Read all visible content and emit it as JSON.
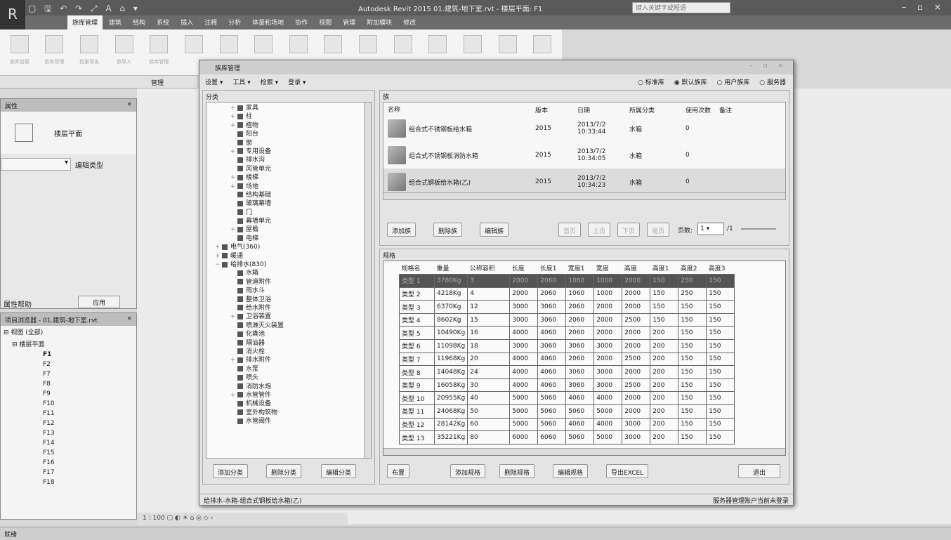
{
  "app": {
    "title": "Autodesk Revit 2015    01.建筑-地下室.rvt - 楼层平面: F1",
    "search_placeholder": "键入关键字或短语",
    "quick_access": "▢ 🖫 ↶ ↷ ⤢ A ⌂ ▾",
    "window_controls": "– ▫ ×",
    "app_button": "R"
  },
  "ribbon": {
    "tabs": [
      "族库管理",
      "建筑",
      "结构",
      "系统",
      "插入",
      "注释",
      "分析",
      "体量和场地",
      "协作",
      "视图",
      "管理",
      "附加模块",
      "修改"
    ],
    "buttons": [
      "族库加载",
      "族库管理",
      "批量导出",
      "族导入",
      "族库管理"
    ],
    "panel_label": "管理"
  },
  "properties": {
    "title": "属性",
    "close": "×",
    "type_name": "楼层平面",
    "edit_type": "编辑类型",
    "help": "属性帮助",
    "apply": "应用"
  },
  "browser": {
    "title": "项目浏览器 - 01.建筑-地下室.rvt",
    "close": "×",
    "root": "视图 (全部)",
    "group": "楼层平面",
    "levels": [
      "F1",
      "F2",
      "F7",
      "F8",
      "F9",
      "F10",
      "F11",
      "F12",
      "F13",
      "F14",
      "F15",
      "F16",
      "F17",
      "F18"
    ]
  },
  "dialog": {
    "title": "族库管理",
    "toolbar": [
      "设置 ▾",
      "工具 ▾",
      "检索 ▾",
      "登录 ▾"
    ],
    "sources": [
      {
        "label": "标准库",
        "checked": false
      },
      {
        "label": "默认族库",
        "checked": true
      },
      {
        "label": "用户族库",
        "checked": false
      },
      {
        "label": "服务器",
        "checked": false
      }
    ],
    "category_label": "分类",
    "tree": [
      {
        "l": 2,
        "t": "家具",
        "e": "+"
      },
      {
        "l": 2,
        "t": "柱",
        "e": "+"
      },
      {
        "l": 2,
        "t": "植物",
        "e": "+"
      },
      {
        "l": 2,
        "t": "阳台",
        "e": ""
      },
      {
        "l": 2,
        "t": "窗",
        "e": ""
      },
      {
        "l": 2,
        "t": "专用设备",
        "e": "+"
      },
      {
        "l": 2,
        "t": "排水沟",
        "e": ""
      },
      {
        "l": 2,
        "t": "风管单元",
        "e": ""
      },
      {
        "l": 2,
        "t": "楼梯",
        "e": "+"
      },
      {
        "l": 2,
        "t": "场地",
        "e": "+"
      },
      {
        "l": 2,
        "t": "结构基础",
        "e": ""
      },
      {
        "l": 2,
        "t": "玻璃幕墙",
        "e": ""
      },
      {
        "l": 2,
        "t": "门",
        "e": ""
      },
      {
        "l": 2,
        "t": "幕墙单元",
        "e": ""
      },
      {
        "l": 2,
        "t": "屋檐",
        "e": "+"
      },
      {
        "l": 2,
        "t": "电梯",
        "e": ""
      },
      {
        "l": 1,
        "t": "电气(360)",
        "e": "+"
      },
      {
        "l": 1,
        "t": "暖通",
        "e": "+"
      },
      {
        "l": 1,
        "t": "给排水(830)",
        "e": "−"
      },
      {
        "l": 2,
        "t": "水箱",
        "e": ""
      },
      {
        "l": 2,
        "t": "管道附件",
        "e": ""
      },
      {
        "l": 2,
        "t": "雨水斗",
        "e": ""
      },
      {
        "l": 2,
        "t": "整体卫浴",
        "e": ""
      },
      {
        "l": 2,
        "t": "给水附件",
        "e": ""
      },
      {
        "l": 2,
        "t": "卫浴装置",
        "e": "+"
      },
      {
        "l": 2,
        "t": "喷淋灭火装置",
        "e": ""
      },
      {
        "l": 2,
        "t": "化粪池",
        "e": ""
      },
      {
        "l": 2,
        "t": "隔油器",
        "e": ""
      },
      {
        "l": 2,
        "t": "消火栓",
        "e": ""
      },
      {
        "l": 2,
        "t": "排水附件",
        "e": "+"
      },
      {
        "l": 2,
        "t": "水泵",
        "e": ""
      },
      {
        "l": 2,
        "t": "喷头",
        "e": ""
      },
      {
        "l": 2,
        "t": "消防水炮",
        "e": ""
      },
      {
        "l": 2,
        "t": "水管管件",
        "e": "+"
      },
      {
        "l": 2,
        "t": "机械设备",
        "e": ""
      },
      {
        "l": 2,
        "t": "室外构筑物",
        "e": ""
      },
      {
        "l": 2,
        "t": "水管阀件",
        "e": ""
      }
    ],
    "category_buttons": [
      "添加分类",
      "删除分类",
      "编辑分类"
    ],
    "family_label": "族",
    "family_headers": [
      "名称",
      "版本",
      "日期",
      "所属分类",
      "使用次数",
      "备注"
    ],
    "families": [
      {
        "name": "组合式不锈钢板给水箱",
        "version": "2015",
        "date": "2013/7/2 10:33:44",
        "category": "水箱",
        "uses": "0"
      },
      {
        "name": "组合式不锈钢板消防水箱",
        "version": "2015",
        "date": "2013/7/2 10:34:05",
        "category": "水箱",
        "uses": "0"
      },
      {
        "name": "组合式钢板给水箱(乙)",
        "version": "2015",
        "date": "2013/7/2 10:34:23",
        "category": "水箱",
        "uses": "0"
      }
    ],
    "family_buttons": [
      "添加族",
      "删除族",
      "编辑族"
    ],
    "pager": {
      "first": "首页",
      "prev": "上页",
      "next": "下页",
      "last": "尾页",
      "label": "页数:",
      "page": "1",
      "total": "/1"
    },
    "spec_label": "规格",
    "spec_headers": [
      "规格名",
      "重量",
      "公称容积",
      "长度",
      "长度1",
      "宽度1",
      "宽度",
      "高度",
      "高度1",
      "高度2",
      "高度3"
    ],
    "specs": [
      [
        "类型 1",
        "3780Kg",
        "3",
        "2000",
        "2060",
        "1060",
        "1000",
        "2000",
        "150",
        "250",
        "150"
      ],
      [
        "类型 2",
        "4218Kg",
        "4",
        "2000",
        "2060",
        "1060",
        "1000",
        "2000",
        "150",
        "250",
        "150"
      ],
      [
        "类型 3",
        "6370Kg",
        "12",
        "3000",
        "3060",
        "2060",
        "2000",
        "2000",
        "150",
        "150",
        "150"
      ],
      [
        "类型 4",
        "8602Kg",
        "15",
        "3000",
        "3060",
        "2060",
        "2000",
        "2500",
        "150",
        "150",
        "150"
      ],
      [
        "类型 5",
        "10490Kg",
        "16",
        "4000",
        "4060",
        "2060",
        "2000",
        "2000",
        "200",
        "150",
        "150"
      ],
      [
        "类型 6",
        "11098Kg",
        "18",
        "3000",
        "3060",
        "3060",
        "3000",
        "2000",
        "200",
        "150",
        "150"
      ],
      [
        "类型 7",
        "11968Kg",
        "20",
        "4000",
        "4060",
        "2060",
        "2000",
        "2500",
        "200",
        "150",
        "150"
      ],
      [
        "类型 8",
        "14048Kg",
        "24",
        "4000",
        "4060",
        "3060",
        "3000",
        "2000",
        "200",
        "150",
        "150"
      ],
      [
        "类型 9",
        "16058Kg",
        "30",
        "4000",
        "4060",
        "3060",
        "3000",
        "2500",
        "200",
        "150",
        "150"
      ],
      [
        "类型 10",
        "20955Kg",
        "40",
        "5000",
        "5060",
        "4060",
        "4000",
        "2000",
        "200",
        "150",
        "150"
      ],
      [
        "类型 11",
        "24068Kg",
        "50",
        "5000",
        "5060",
        "5060",
        "5000",
        "2000",
        "200",
        "150",
        "150"
      ],
      [
        "类型 12",
        "28142Kg",
        "60",
        "5000",
        "5060",
        "4060",
        "4000",
        "3000",
        "200",
        "150",
        "150"
      ],
      [
        "类型 13",
        "35221Kg",
        "80",
        "6000",
        "6060",
        "5060",
        "5000",
        "3000",
        "200",
        "150",
        "150"
      ]
    ],
    "place_button": "布置",
    "spec_buttons": [
      "添加规格",
      "删除规格",
      "编辑规格",
      "导出EXCEL"
    ],
    "exit_button": "退出",
    "status_left": "给排水-水箱-组合式钢板给水箱(乙)",
    "status_right": "服务器管理账户当前未登录"
  },
  "status": {
    "text": "就绪",
    "view_controls": "1 : 100  ▢ ◐ ☀ ⌂ ◎ ◇ ‹"
  }
}
